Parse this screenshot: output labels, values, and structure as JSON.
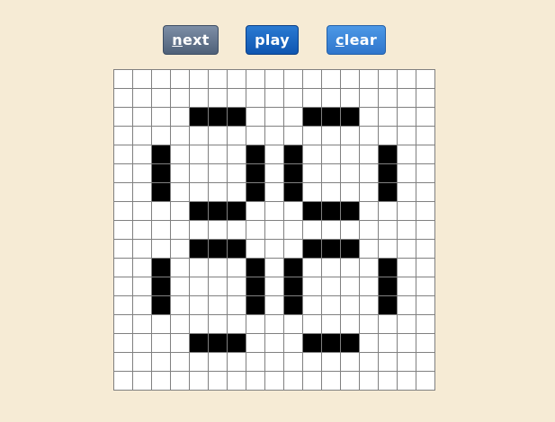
{
  "buttons": {
    "next": {
      "hotkey": "n",
      "rest": "ext"
    },
    "play": {
      "label": "play"
    },
    "clear": {
      "hotkey": "c",
      "rest": "lear"
    }
  },
  "board": {
    "rows": 17,
    "cols": 17,
    "live_color": "#000000",
    "dead_color": "#ffffff",
    "grid_line_color": "#808080",
    "live_cells": [
      [
        2,
        4
      ],
      [
        2,
        5
      ],
      [
        2,
        6
      ],
      [
        2,
        10
      ],
      [
        2,
        11
      ],
      [
        2,
        12
      ],
      [
        4,
        2
      ],
      [
        4,
        7
      ],
      [
        4,
        9
      ],
      [
        4,
        14
      ],
      [
        5,
        2
      ],
      [
        5,
        7
      ],
      [
        5,
        9
      ],
      [
        5,
        14
      ],
      [
        6,
        2
      ],
      [
        6,
        7
      ],
      [
        6,
        9
      ],
      [
        6,
        14
      ],
      [
        7,
        4
      ],
      [
        7,
        5
      ],
      [
        7,
        6
      ],
      [
        7,
        10
      ],
      [
        7,
        11
      ],
      [
        7,
        12
      ],
      [
        9,
        4
      ],
      [
        9,
        5
      ],
      [
        9,
        6
      ],
      [
        9,
        10
      ],
      [
        9,
        11
      ],
      [
        9,
        12
      ],
      [
        10,
        2
      ],
      [
        10,
        7
      ],
      [
        10,
        9
      ],
      [
        10,
        14
      ],
      [
        11,
        2
      ],
      [
        11,
        7
      ],
      [
        11,
        9
      ],
      [
        11,
        14
      ],
      [
        12,
        2
      ],
      [
        12,
        7
      ],
      [
        12,
        9
      ],
      [
        12,
        14
      ],
      [
        14,
        4
      ],
      [
        14,
        5
      ],
      [
        14,
        6
      ],
      [
        14,
        10
      ],
      [
        14,
        11
      ],
      [
        14,
        12
      ]
    ]
  }
}
